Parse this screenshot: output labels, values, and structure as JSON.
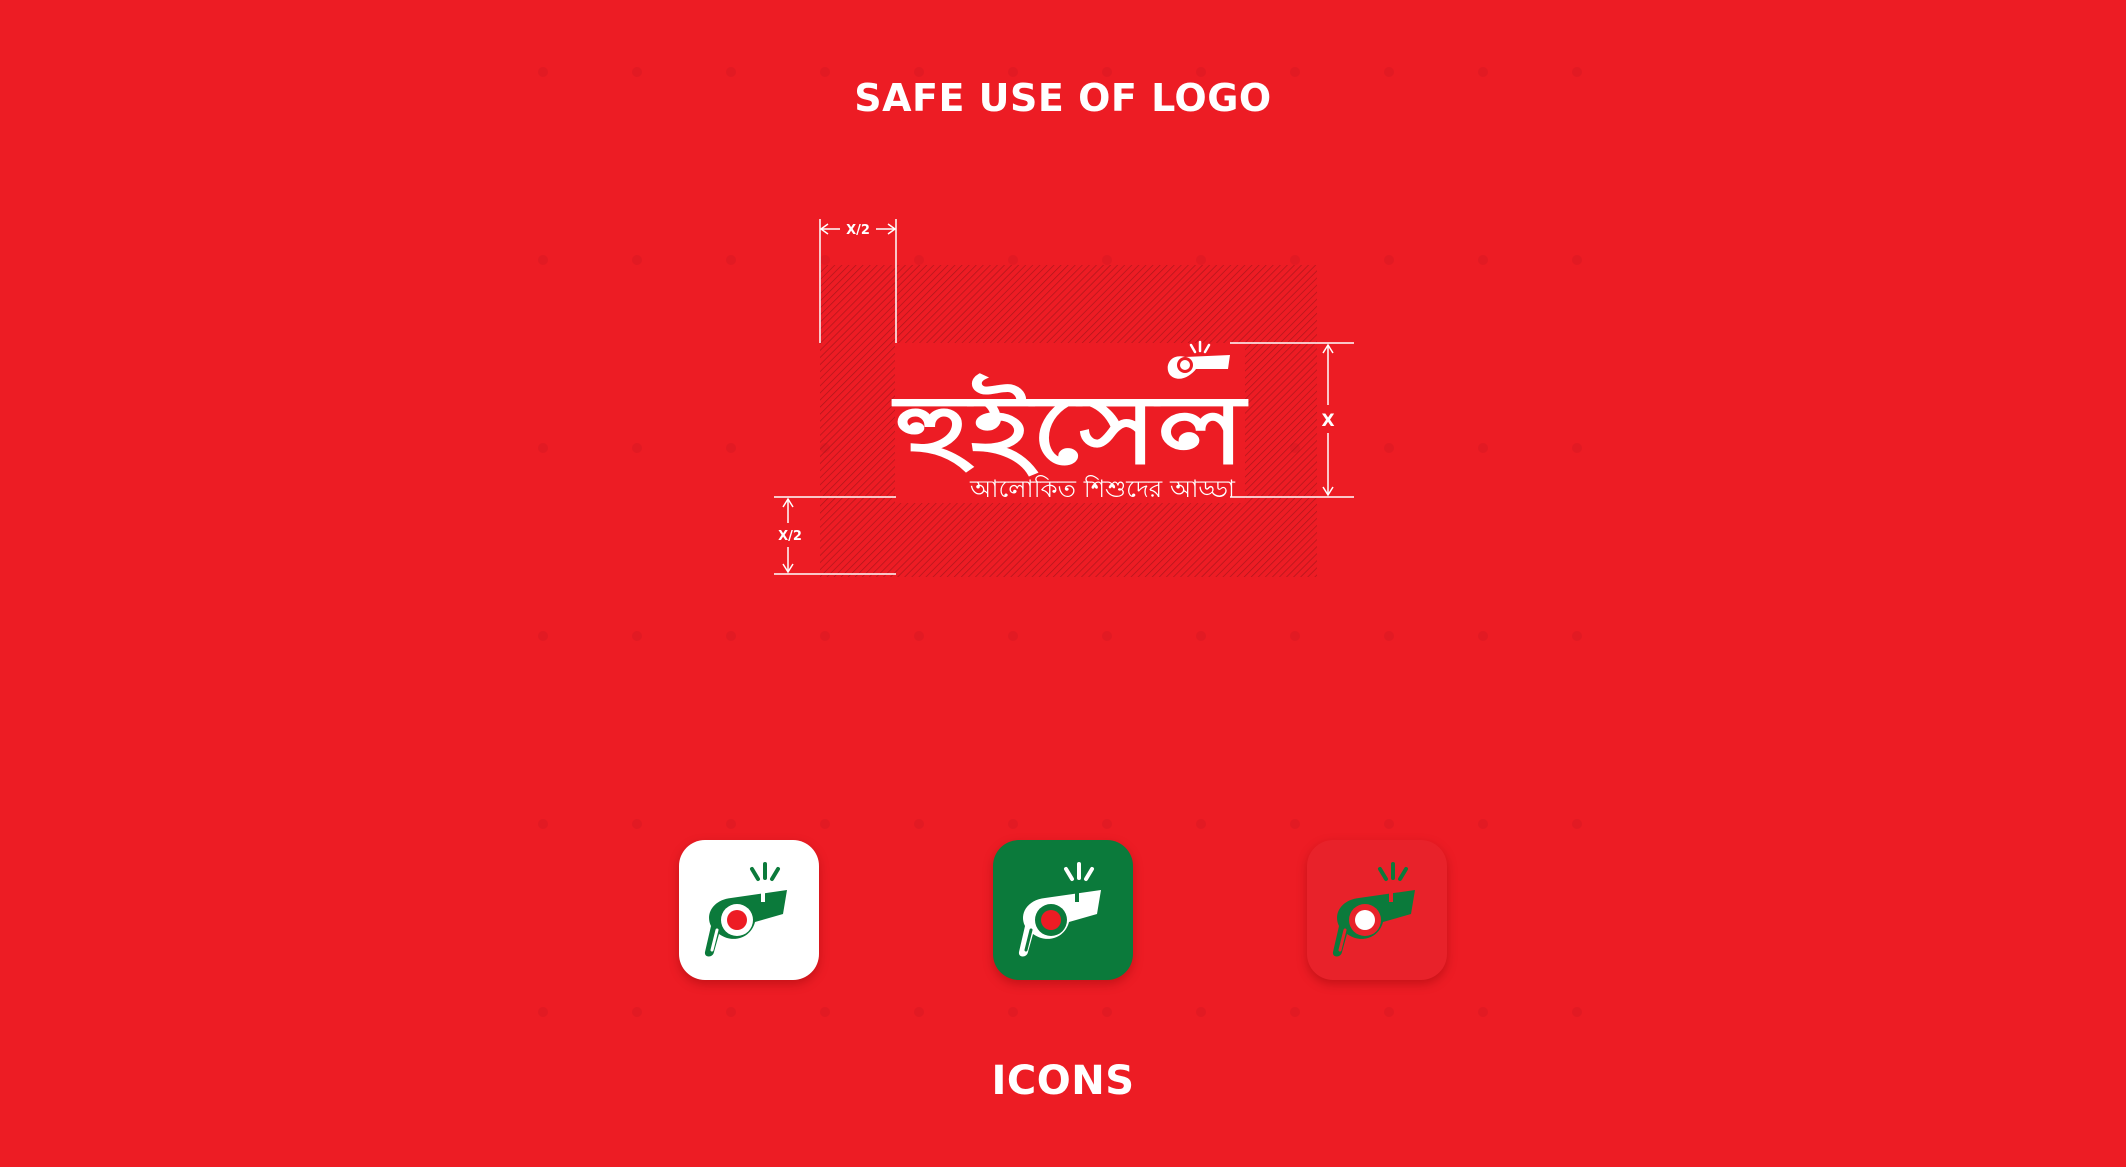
{
  "title": "SAFE USE OF LOGO",
  "footer_title": "ICONS",
  "logo": {
    "wordmark": "হুইসেল",
    "tagline": "আলোকিত শিশুদের আড্ডা"
  },
  "dimensions": {
    "half_x_top": "X/2",
    "x_height": "X",
    "half_x_left": "X/2"
  },
  "icons": [
    {
      "variant": "white",
      "background": "#ffffff",
      "whistle": "#0b7a3b",
      "dot": "#ed1c24"
    },
    {
      "variant": "green",
      "background": "#0b7a3b",
      "whistle": "#ffffff",
      "dot": "#ed1c24"
    },
    {
      "variant": "red",
      "background": "#e8222a",
      "whistle": "#0b7a3b",
      "dot": "#ffffff"
    }
  ],
  "colors": {
    "background": "#ed1c24",
    "brand_green": "#0b7a3b",
    "white": "#ffffff"
  }
}
